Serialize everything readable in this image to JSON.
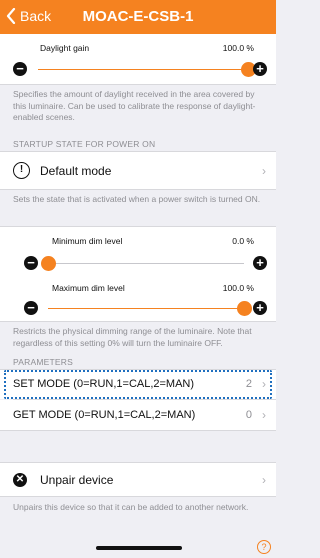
{
  "nav": {
    "back_label": "Back",
    "title": "MOAC-E-CSB-1"
  },
  "daylight": {
    "label": "Daylight gain",
    "value_text": "100.0 %",
    "level_percent": 100,
    "minus_glyph": "−",
    "plus_glyph": "+",
    "description": "Specifies the amount of daylight received in the area covered by this luminaire. Can be used to calibrate the response of daylight-enabled scenes."
  },
  "startup": {
    "header": "STARTUP STATE FOR POWER ON",
    "row_label": "Default mode",
    "icon_glyph": "!",
    "chevron": "›",
    "description": "Sets the state that is activated when a power switch is turned ON."
  },
  "dim": {
    "min_label": "Minimum dim level",
    "min_value_text": "0.0 %",
    "min_level_percent": 0,
    "max_label": "Maximum dim level",
    "max_value_text": "100.0 %",
    "max_level_percent": 100,
    "minus_glyph": "−",
    "plus_glyph": "+",
    "description": "Restricts the physical dimming range of the luminaire. Note that regardless of this setting 0% will turn the luminaire OFF."
  },
  "parameters": {
    "header": "PARAMETERS",
    "items": [
      {
        "label": "SET MODE (0=RUN,1=CAL,2=MAN)",
        "value": "2",
        "chevron": "›"
      },
      {
        "label": "GET MODE (0=RUN,1=CAL,2=MAN)",
        "value": "0",
        "chevron": "›"
      }
    ]
  },
  "unpair": {
    "row_label": "Unpair device",
    "icon_glyph": "✕",
    "chevron": "›",
    "description": "Unpairs this device so that it can be added to another network."
  },
  "help_glyph": "?",
  "colors": {
    "accent": "#f58220",
    "highlight": "#1f6fbf",
    "background": "#efeff4"
  }
}
